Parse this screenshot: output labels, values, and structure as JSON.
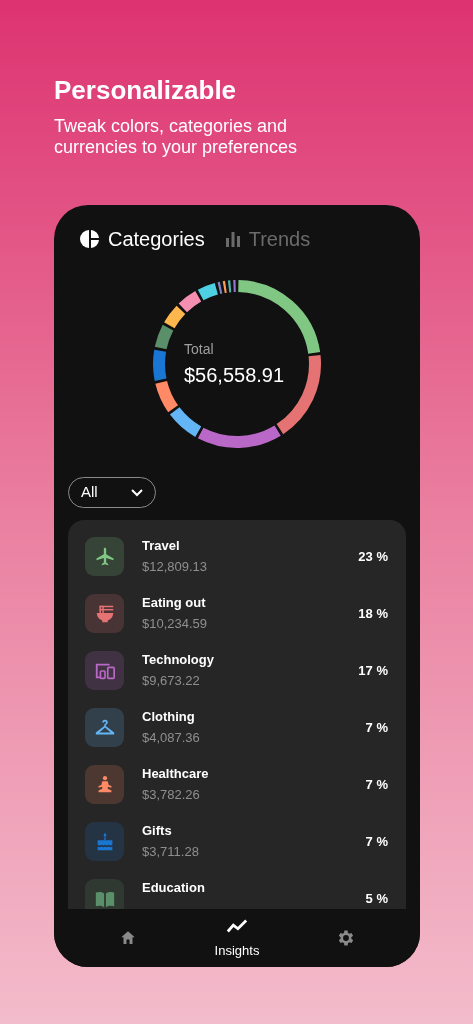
{
  "headline": "Personalizable",
  "subtitle": "Tweak colors, categories and currencies to your preferences",
  "tabs": [
    {
      "label": "Categories",
      "kind": "pie",
      "selected": true
    },
    {
      "label": "Trends",
      "kind": "bars",
      "selected": false
    }
  ],
  "total": {
    "label": "Total",
    "value": "$56,558.91"
  },
  "filter": {
    "value": "All"
  },
  "categories": [
    {
      "name": "Travel",
      "amount": "$12,809.13",
      "percent": "23 %",
      "kind": "plane",
      "color": "#81c784"
    },
    {
      "name": "Eating out",
      "amount": "$10,234.59",
      "percent": "18 %",
      "kind": "bowl",
      "color": "#e57373"
    },
    {
      "name": "Technology",
      "amount": "$9,673.22",
      "percent": "17 %",
      "kind": "devices",
      "color": "#ba68c8"
    },
    {
      "name": "Clothing",
      "amount": "$4,087.36",
      "percent": "7 %",
      "kind": "hanger",
      "color": "#64b5f6"
    },
    {
      "name": "Healthcare",
      "amount": "$3,782.26",
      "percent": "7 %",
      "kind": "person",
      "color": "#ff8a65"
    },
    {
      "name": "Gifts",
      "amount": "$3,711.28",
      "percent": "7 %",
      "kind": "cake",
      "color": "#1976d2"
    },
    {
      "name": "Education",
      "percent": "5 %",
      "kind": "book",
      "color": "#5a8f69"
    }
  ],
  "nav": [
    {
      "kind": "home",
      "selected": false
    },
    {
      "kind": "trend",
      "label": "Insights",
      "selected": true
    },
    {
      "kind": "gear",
      "selected": false
    }
  ]
}
